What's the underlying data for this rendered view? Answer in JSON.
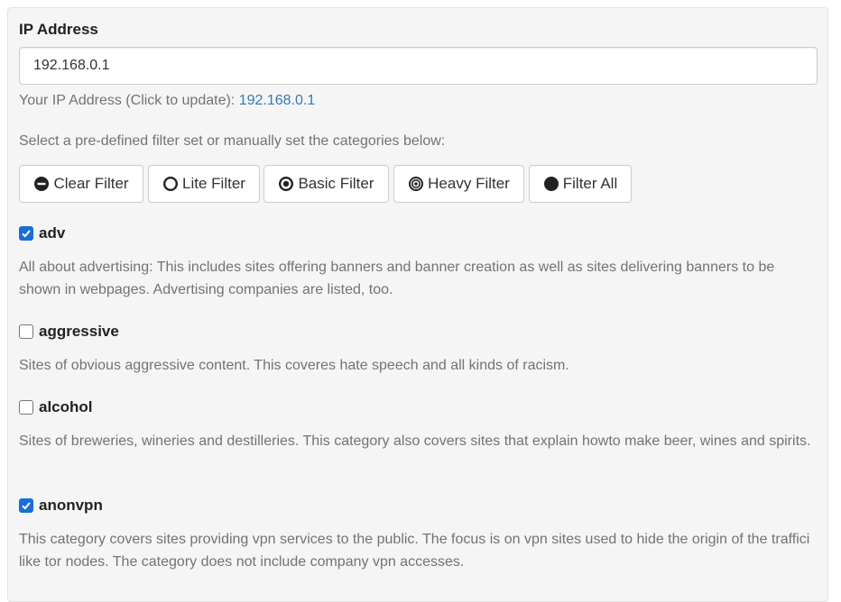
{
  "ip": {
    "label": "IP Address",
    "value": "192.168.0.1",
    "help_prefix": "Your IP Address (Click to update): ",
    "help_link": "192.168.0.1"
  },
  "presets": {
    "help": "Select a pre-defined filter set or manually set the categories below:",
    "buttons": [
      {
        "label": "Clear Filter",
        "icon": "minus-circle-icon"
      },
      {
        "label": "Lite Filter",
        "icon": "circle-outline-icon"
      },
      {
        "label": "Basic Filter",
        "icon": "dot-circle-icon"
      },
      {
        "label": "Heavy Filter",
        "icon": "bullseye-icon"
      },
      {
        "label": "Filter All",
        "icon": "filled-circle-icon"
      }
    ]
  },
  "categories": [
    {
      "name": "adv",
      "checked": true,
      "description": "All about advertising: This includes sites offering banners and banner creation as well as sites delivering banners to be shown in webpages. Advertising companies are listed, too."
    },
    {
      "name": "aggressive",
      "checked": false,
      "description": "Sites of obvious aggressive content. This coveres hate speech and all kinds of racism."
    },
    {
      "name": "alcohol",
      "checked": false,
      "description": "Sites of breweries, wineries and destilleries. This category also covers sites that explain howto make beer, wines and spirits."
    },
    {
      "name": "anonvpn",
      "checked": true,
      "description": "This category covers sites providing vpn services to the public. The focus is on vpn sites used to hide the origin of the traffici like tor nodes. The category does not include company vpn accesses."
    }
  ],
  "colors": {
    "link": "#337ab7",
    "checkbox": "#1a6fd6"
  }
}
